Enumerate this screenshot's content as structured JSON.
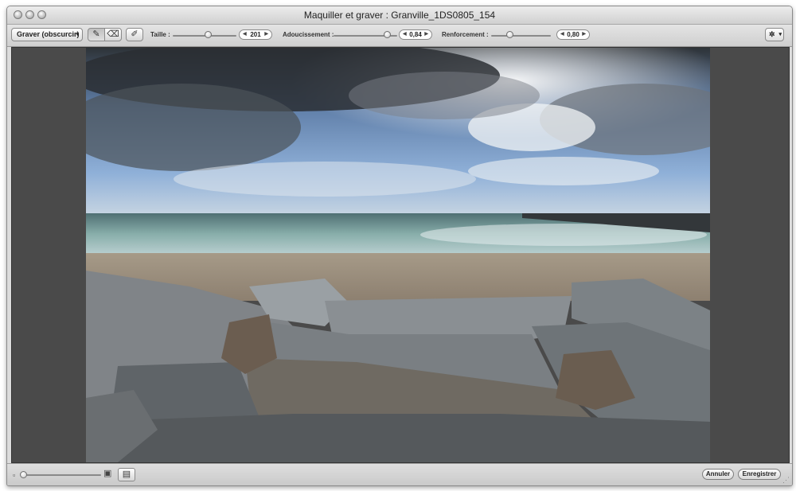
{
  "window": {
    "title": "Maquiller et graver : Granville_1DS0805_154"
  },
  "toolbar": {
    "mode_popup": "Graver (obscurcir)",
    "tools": [
      {
        "name": "brush-icon",
        "glyph": "✎"
      },
      {
        "name": "eraser-icon",
        "glyph": "⌫"
      },
      {
        "name": "feather-brush-icon",
        "glyph": "✐"
      }
    ],
    "size": {
      "label": "Taille :",
      "value": "201",
      "level": 0.55
    },
    "softness": {
      "label": "Adoucissement :",
      "value": "0,84",
      "level": 0.84
    },
    "strength": {
      "label": "Renforcement :",
      "value": "0,80",
      "level": 0.3
    },
    "gear_icon": "gear-icon"
  },
  "statusbar": {
    "zoom_min_icon": "small-photo-icon",
    "zoom_max_icon": "large-photo-icon",
    "zoom_level": 0.02,
    "filmstrip_icon": "filmstrip-icon",
    "cancel_label": "Annuler",
    "save_label": "Enregistrer"
  },
  "colors": {
    "window_bg": "#dcdcdc",
    "canvas_bg": "#4a4a4a",
    "sky": "#6f95c8",
    "sea": "#7fa8a6"
  }
}
